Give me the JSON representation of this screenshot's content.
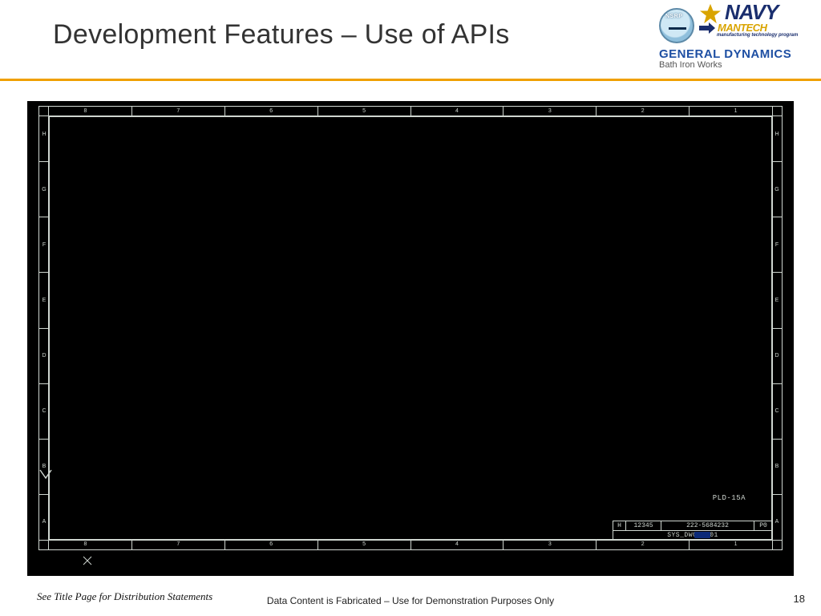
{
  "header": {
    "title": "Development Features – Use of APIs",
    "logos": {
      "nsrp_label": "NSRP",
      "navy_word": "NAVY",
      "mantech_word": "MANTECH",
      "mantech_tagline": "manufacturing technology program",
      "gd_name": "GENERAL DYNAMICS",
      "gd_sub": "Bath Iron Works"
    }
  },
  "cad": {
    "top_ruler": [
      "8",
      "7",
      "6",
      "5",
      "4",
      "3",
      "2",
      "1"
    ],
    "bottom_ruler": [
      "8",
      "7",
      "6",
      "5",
      "4",
      "3",
      "2",
      "1"
    ],
    "left_ruler": [
      "H",
      "G",
      "F",
      "E",
      "D",
      "C",
      "B",
      "A"
    ],
    "right_ruler": [
      "H",
      "G",
      "F",
      "E",
      "D",
      "C",
      "B",
      "A"
    ],
    "pld_label": "PLD-15A",
    "title_block": {
      "size": "H",
      "cage": "12345",
      "drawing_no": "222-5684232",
      "doc_id": "SYS_DWG-0001",
      "rev": "P0"
    }
  },
  "footer": {
    "left": "See Title Page for Distribution Statements",
    "mid": "Data Content is Fabricated – Use for Demonstration Purposes Only",
    "page": "18"
  }
}
